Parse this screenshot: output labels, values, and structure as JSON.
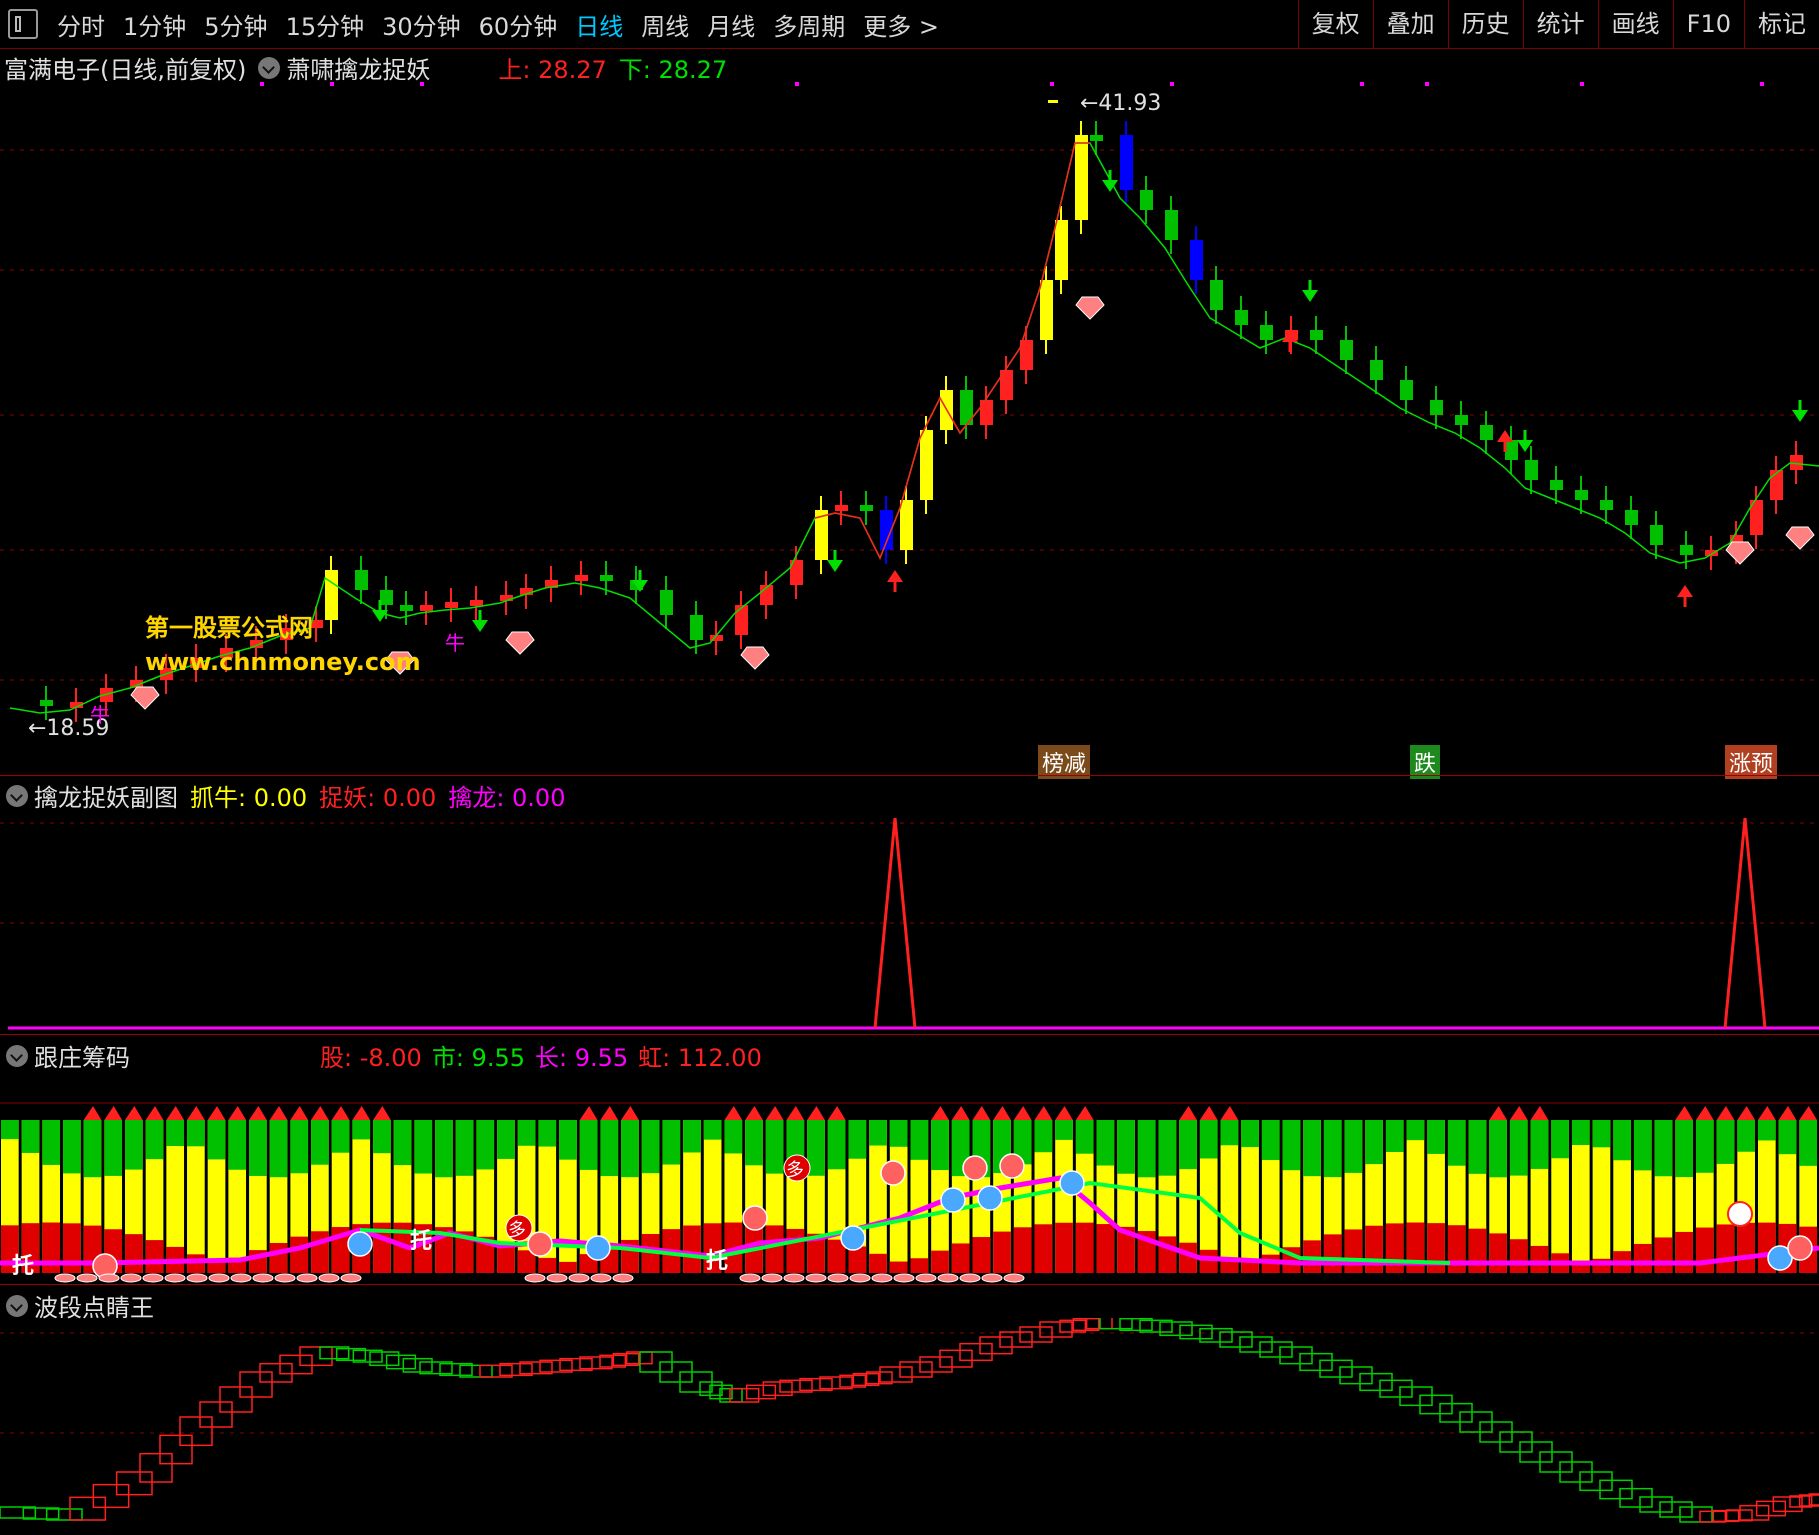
{
  "toolbar": {
    "periods": [
      "分时",
      "1分钟",
      "5分钟",
      "15分钟",
      "30分钟",
      "60分钟",
      "日线",
      "周线",
      "月线",
      "多周期",
      "更多 >"
    ],
    "active_period": "日线",
    "right_buttons": [
      "复权",
      "叠加",
      "历史",
      "统计",
      "画线",
      "F10",
      "标记"
    ]
  },
  "main": {
    "title": "富满电子(日线,前复权)",
    "indicator": "萧啸擒龙捉妖",
    "upper_label": "上",
    "upper_value": "28.27",
    "lower_label": "下",
    "lower_value": "28.27",
    "high_label": "41.93",
    "low_label": "18.59",
    "watermark_line1": "第一股票公式网",
    "watermark_line2": "www.chnmoney.com",
    "tags": [
      {
        "text": "榜减",
        "color": "#7a4a1a"
      },
      {
        "text": "跌",
        "color": "#1e8a1e"
      },
      {
        "text": "涨预",
        "color": "#b04020"
      }
    ],
    "markers": [
      "牛",
      "牛"
    ],
    "colors": {
      "up": "#ff2020",
      "down": "#00c000",
      "strong_up": "#ffff00",
      "strong_down": "#0000ff",
      "ma": "#00e000"
    }
  },
  "sub1": {
    "title": "擒龙捉妖副图",
    "labels": [
      {
        "name": "抓牛",
        "value": "0.00",
        "color": "#ffff00"
      },
      {
        "name": "捉妖",
        "value": "0.00",
        "color": "#ff2020"
      },
      {
        "name": "擒龙",
        "value": "0.00",
        "color": "#ff00ff"
      }
    ]
  },
  "sub2": {
    "title": "跟庄筹码",
    "labels": [
      {
        "name": "股",
        "value": "-8.00",
        "color": "#ff2020"
      },
      {
        "name": "市",
        "value": "9.55",
        "color": "#00e000"
      },
      {
        "name": "长",
        "value": "9.55",
        "color": "#ff00ff"
      },
      {
        "name": "虹",
        "value": "112.00",
        "color": "#ff2020"
      }
    ],
    "markers": [
      "托",
      "托",
      "托",
      "多",
      "多"
    ]
  },
  "sub3": {
    "title": "波段点睛王"
  }
}
